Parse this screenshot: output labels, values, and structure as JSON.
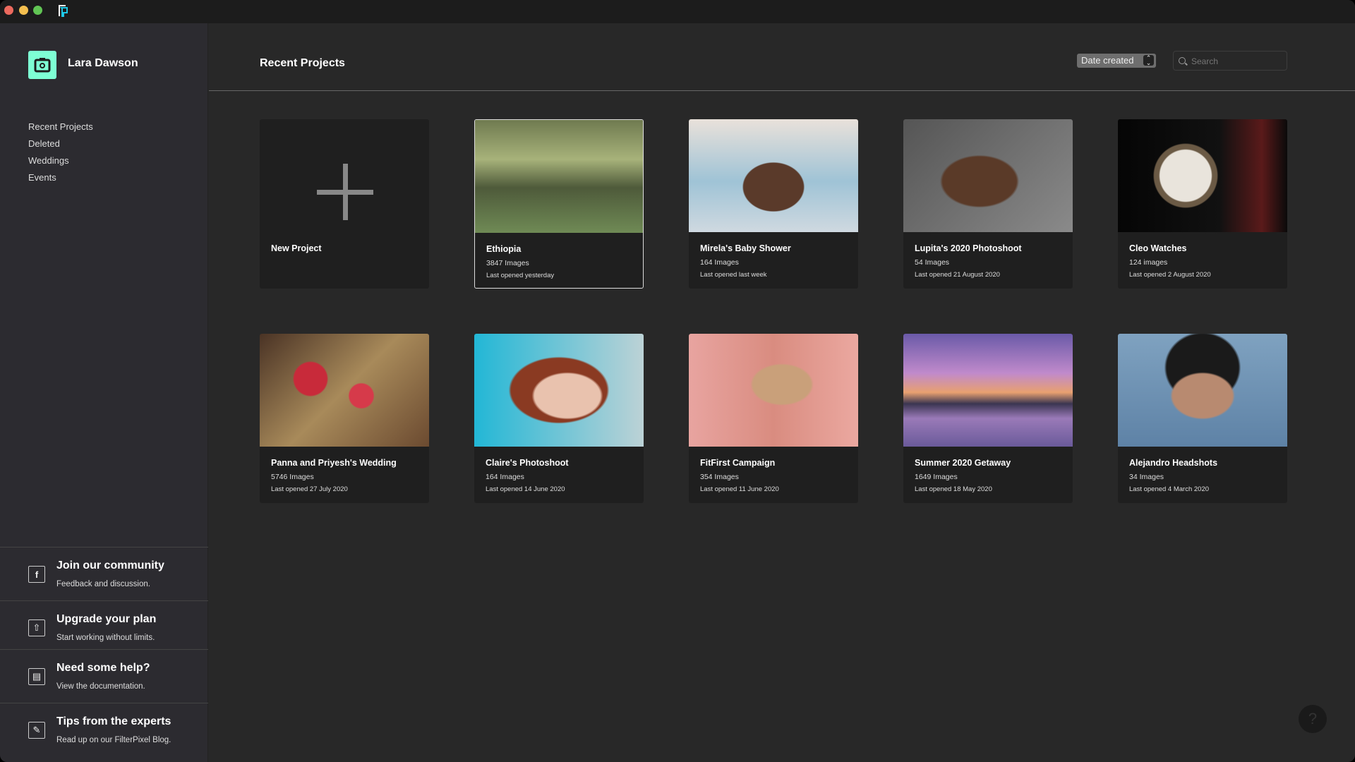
{
  "window": {
    "controls": {
      "close": "#ec6a5e",
      "minimize": "#f4bf4f",
      "maximize": "#61c554"
    },
    "app_icon": "filterpixel-logo"
  },
  "user": {
    "name": "Lara Dawson",
    "avatar_color": "#7effd4",
    "avatar_icon": "camera-icon"
  },
  "sidebar": {
    "items": [
      {
        "label": "Recent Projects"
      },
      {
        "label": "Deleted"
      },
      {
        "label": "Weddings"
      },
      {
        "label": "Events"
      }
    ]
  },
  "help_links": [
    {
      "title": "Join our community",
      "subtitle": "Feedback and discussion.",
      "icon": "facebook-icon"
    },
    {
      "title": "Upgrade your plan",
      "subtitle": "Start working without limits.",
      "icon": "upgrade-arrow-icon"
    },
    {
      "title": "Need some help?",
      "subtitle": "View the documentation.",
      "icon": "document-icon"
    },
    {
      "title": "Tips from the experts",
      "subtitle": "Read up on our FilterPixel Blog.",
      "icon": "chat-bubble-icon"
    }
  ],
  "header": {
    "title": "Recent Projects",
    "sort_value": "Date created",
    "search_placeholder": "Search"
  },
  "new_project": {
    "label": "New Project"
  },
  "projects": [
    {
      "name": "Ethiopia",
      "count": "3847 Images",
      "opened": "Last opened yesterday",
      "selected": true
    },
    {
      "name": "Mirela's Baby Shower",
      "count": "164 Images",
      "opened": "Last opened last week"
    },
    {
      "name": "Lupita's 2020 Photoshoot",
      "count": "54 Images",
      "opened": "Last opened 21 August 2020"
    },
    {
      "name": "Cleo Watches",
      "count": "124 images",
      "opened": "Last opened 2 August 2020"
    },
    {
      "name": "Panna and Priyesh's Wedding",
      "count": "5746 Images",
      "opened": "Last opened 27 July 2020"
    },
    {
      "name": "Claire's Photoshoot",
      "count": "164 Images",
      "opened": "Last opened 14 June 2020"
    },
    {
      "name": "FitFirst Campaign",
      "count": "354 Images",
      "opened": "Last opened 11 June 2020"
    },
    {
      "name": "Summer 2020 Getaway",
      "count": "1649 Images",
      "opened": "Last opened 18 May 2020"
    },
    {
      "name": "Alejandro Headshots",
      "count": "34 Images",
      "opened": "Last opened 4 March 2020"
    }
  ],
  "help_button": {
    "label": "?"
  }
}
